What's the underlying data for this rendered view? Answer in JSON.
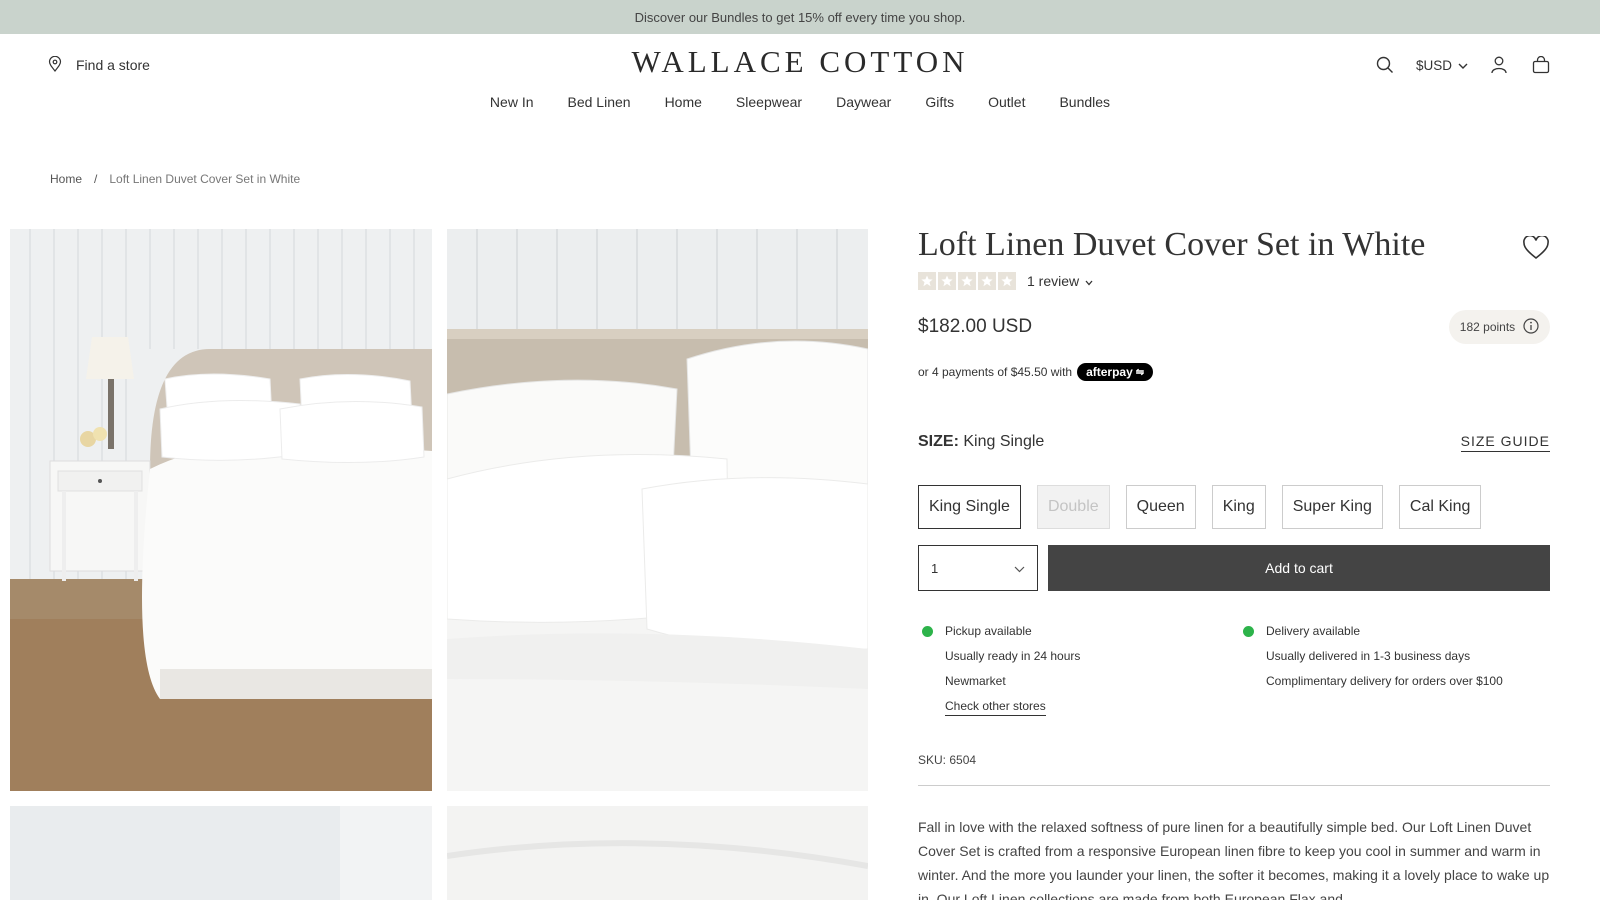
{
  "announcement": "Discover our Bundles to get 15% off every time you shop.",
  "header": {
    "store_link": "Find a store",
    "logo": "WALLACE COTTON",
    "currency": "$USD"
  },
  "nav": [
    "New In",
    "Bed Linen",
    "Home",
    "Sleepwear",
    "Daywear",
    "Gifts",
    "Outlet",
    "Bundles"
  ],
  "breadcrumb": {
    "home": "Home",
    "sep": "/",
    "current": "Loft Linen Duvet Cover Set in White"
  },
  "product": {
    "title": "Loft Linen Duvet Cover Set in White",
    "reviews": "1 review",
    "price": "$182.00 USD",
    "points": "182 points",
    "afterpay_text": "or 4 payments of $45.50 with",
    "afterpay_brand": "afterpay",
    "size_label": "SIZE:",
    "size_selected": "King Single",
    "size_guide": "SIZE GUIDE",
    "sizes": [
      {
        "label": "King Single",
        "state": "active"
      },
      {
        "label": "Double",
        "state": "disabled"
      },
      {
        "label": "Queen",
        "state": "normal"
      },
      {
        "label": "King",
        "state": "normal"
      },
      {
        "label": "Super King",
        "state": "normal"
      },
      {
        "label": "Cal King",
        "state": "normal"
      }
    ],
    "quantity": "1",
    "add_to_cart": "Add to cart",
    "pickup": {
      "title": "Pickup available",
      "line1": "Usually ready in 24 hours",
      "line2": "Newmarket",
      "link": "Check other stores"
    },
    "delivery": {
      "title": "Delivery available",
      "line1": "Usually delivered in 1-3 business days",
      "line2": "Complimentary delivery for orders over $100"
    },
    "sku": "SKU: 6504",
    "description": "Fall in love with the relaxed softness of pure linen for a beautifully simple bed. Our Loft Linen Duvet Cover Set is crafted from a responsive European linen fibre to keep you cool in summer and warm in winter. And the more you launder your linen, the softer it becomes, making it a lovely place to wake up in. Our Loft Linen collections are made from both European Flax and"
  },
  "colors": {
    "announce_bg": "#c9d3cc",
    "button_dark": "#444444",
    "available_green": "#2db34a"
  }
}
